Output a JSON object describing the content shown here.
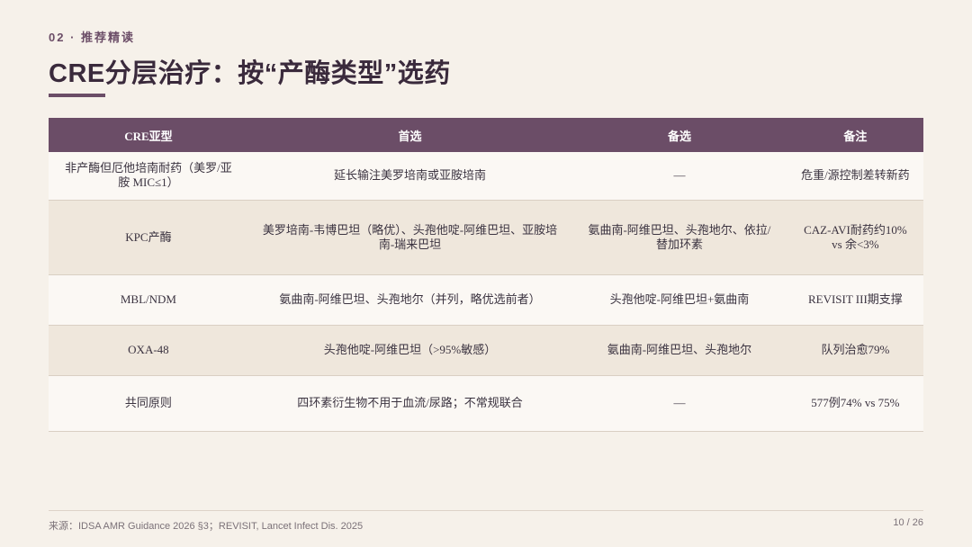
{
  "header": {
    "section_tag": "02 · 推荐精读",
    "title": "CRE分层治疗：按“产酶类型”选药"
  },
  "table": {
    "columns": [
      "CRE亚型",
      "首选",
      "备选",
      "备注"
    ],
    "rows": [
      [
        "非产酶但厄他培南耐药（美罗/亚胺 MIC≤1）",
        "延长输注美罗培南或亚胺培南",
        "—",
        "危重/源控制差转新药"
      ],
      [
        "KPC产酶",
        "美罗培南-韦博巴坦（略优）、头孢他啶-阿维巴坦、亚胺培南-瑞来巴坦",
        "氨曲南-阿维巴坦、头孢地尔、依拉/替加环素",
        "CAZ-AVI耐药约10% vs 余<3%"
      ],
      [
        "MBL/NDM",
        "氨曲南-阿维巴坦、头孢地尔（并列，略优选前者）",
        "头孢他啶-阿维巴坦+氨曲南",
        "REVISIT III期支撑"
      ],
      [
        "OXA-48",
        "头孢他啶-阿维巴坦（>95%敏感）",
        "氨曲南-阿维巴坦、头孢地尔",
        "队列治愈79%"
      ],
      [
        "共同原则",
        "四环素衍生物不用于血流/尿路；不常规联合",
        "—",
        "577例74% vs 75%"
      ]
    ]
  },
  "footer": {
    "source": "来源：IDSA AMR Guidance 2026 §3；REVISIT, Lancet Infect Dis. 2025",
    "page": "10 / 26"
  }
}
